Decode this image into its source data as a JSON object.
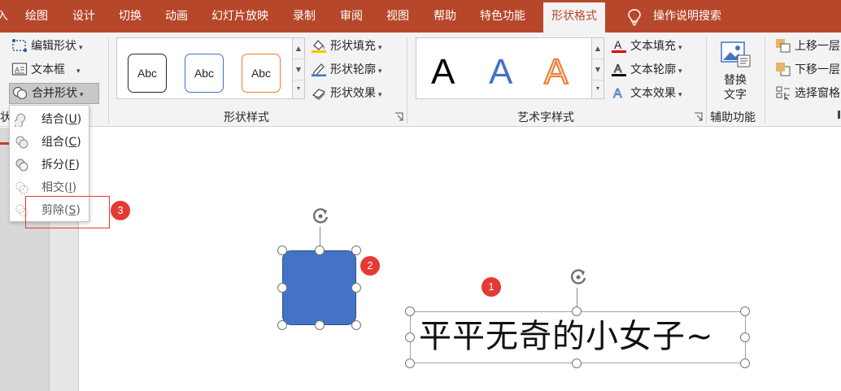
{
  "tabs": [
    {
      "label": "入"
    },
    {
      "label": "绘图"
    },
    {
      "label": "设计"
    },
    {
      "label": "切换"
    },
    {
      "label": "动画"
    },
    {
      "label": "幻灯片放映"
    },
    {
      "label": "录制"
    },
    {
      "label": "审阅"
    },
    {
      "label": "视图"
    },
    {
      "label": "帮助"
    },
    {
      "label": "特色功能"
    },
    {
      "label": "形状格式"
    }
  ],
  "tell_me": "操作说明搜索",
  "insert_shapes": {
    "edit_shape": "编辑形状",
    "text_box": "文本框",
    "merge_shapes": "合并形状",
    "group_label": "状"
  },
  "shape_styles": {
    "samples": [
      "Abc",
      "Abc",
      "Abc"
    ],
    "fill": "形状填充",
    "outline": "形状轮廓",
    "effects": "形状效果",
    "group_label": "形状样式"
  },
  "wordart": {
    "samples": [
      "A",
      "A",
      "A"
    ],
    "text_fill": "文本填充",
    "text_outline": "文本轮廓",
    "text_effects": "文本效果",
    "group_label": "艺术字样式"
  },
  "accessibility": {
    "alt_text_line1": "替换",
    "alt_text_line2": "文字",
    "group_label": "辅助功能"
  },
  "arrange": {
    "bring_forward": "上移一层",
    "send_backward": "下移一层",
    "selection_pane": "选择窗格"
  },
  "merge_menu": [
    {
      "label": "结合(",
      "key": "U",
      "end": ")"
    },
    {
      "label": "组合(",
      "key": "C",
      "end": ")"
    },
    {
      "label": "拆分(",
      "key": "F",
      "end": ")"
    },
    {
      "label": "相交(",
      "key": "I",
      "end": ")"
    },
    {
      "label": "剪除(",
      "key": "S",
      "end": ")"
    }
  ],
  "canvas": {
    "text": "平平无奇的小女子~"
  },
  "badges": [
    "1",
    "2",
    "3"
  ],
  "colors": {
    "tab_bar": "#b7472a",
    "shape_fill": "#4472c4",
    "badge": "#e53935"
  }
}
